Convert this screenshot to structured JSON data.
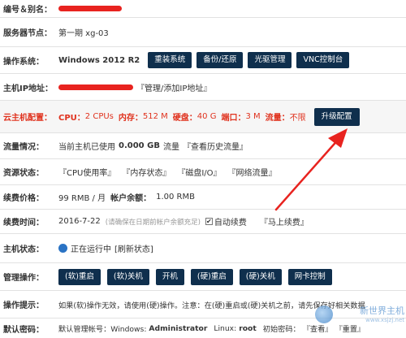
{
  "rows": {
    "alias": {
      "label": "编号＆别名："
    },
    "node": {
      "label": "服务器节点：",
      "value": "第一期   xg-03"
    },
    "os": {
      "label": "操作系统：",
      "value": "Windows 2012 R2",
      "buttons": [
        "重装系统",
        "备份/还原",
        "光驱管理",
        "VNC控制台"
      ]
    },
    "ip": {
      "label": "主机IP地址：",
      "link": "『管理/添加IP地址』"
    },
    "config": {
      "label": "云主机配置：",
      "cpu_label": "CPU：",
      "cpu": "2 CPUs",
      "mem_label": "内存：",
      "mem": "512 M",
      "disk_label": "硬盘：",
      "disk": "40 G",
      "port_label": "端口：",
      "port": "3 M",
      "traffic_label": "流量：",
      "traffic": "不限",
      "upgrade": "升级配置"
    },
    "traffic": {
      "label": "流量情况：",
      "prefix": "当前主机已使用",
      "amount": "0.000 GB",
      "suffix": "流量",
      "link": "『查看历史流量』"
    },
    "resources": {
      "label": "资源状态：",
      "links": [
        "『CPU使用率』",
        "『内存状态』",
        "『磁盘I/O』",
        "『网络流量』"
      ]
    },
    "price": {
      "label": "续费价格：",
      "value": "99 RMB / 月",
      "balance_label": "帐户余额：",
      "balance": "1.00 RMB"
    },
    "renew": {
      "label": "续费时间：",
      "date": "2016-7-22",
      "note": "(请确保在日期前帐户余额充足)",
      "auto_label": "自动续费",
      "auto_checked": "✔",
      "link": "『马上续费』"
    },
    "status": {
      "label": "主机状态：",
      "value": "正在运行中",
      "link": "[刷新状态]"
    },
    "ops": {
      "label": "管理操作：",
      "buttons": [
        "(软)重启",
        "(软)关机",
        "开机",
        "(硬)重启",
        "(硬)关机",
        "网卡控制"
      ]
    },
    "tip": {
      "label": "操作提示：",
      "text": "如果(软)操作无效，请使用(硬)操作。注意：在(硬)重启或(硬)关机之前，请先保存好相关数据"
    },
    "password": {
      "label": "默认密码：",
      "prefix": "默认管理帐号：Windows:",
      "win_user": "Administrator",
      "linux_label": "Linux:",
      "linux_user": "root",
      "pwd_label": "初始密码：",
      "view": "『查看』",
      "reset": "『重置』"
    }
  },
  "watermark": {
    "title": "新世界主机",
    "sub": "www.xsjzj.net"
  },
  "colors": {
    "button": "#0f2f4d",
    "accent_red": "#e0321e",
    "redaction": "#e8231f",
    "arrow": "#e8231f"
  }
}
